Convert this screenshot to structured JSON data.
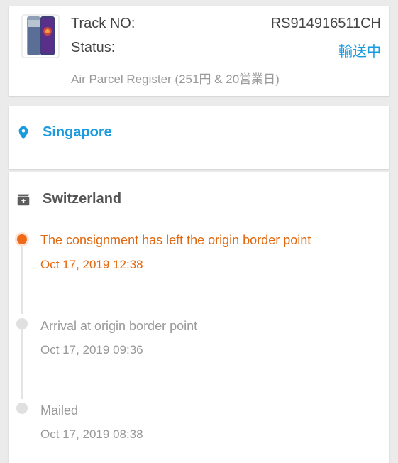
{
  "tracking": {
    "track_label": "Track NO:",
    "track_number": "RS914916511CH",
    "status_label": "Status:",
    "status_value": "輸送中",
    "service": "Air Parcel Register (251円 & 20営業日)"
  },
  "destination": {
    "icon": "location-pin-icon",
    "name": "Singapore"
  },
  "origin": {
    "icon": "archive-box-icon",
    "name": "Switzerland"
  },
  "events": [
    {
      "text": "The consignment has left the origin border point",
      "date": "Oct 17, 2019 12:38",
      "active": true
    },
    {
      "text": "Arrival at origin border point",
      "date": "Oct 17, 2019 09:36",
      "active": false
    },
    {
      "text": "Mailed",
      "date": "Oct 17, 2019 08:38",
      "active": false
    }
  ],
  "colors": {
    "accent_blue": "#1a9be0",
    "active_orange": "#e2660c",
    "background": "#ebebeb"
  }
}
